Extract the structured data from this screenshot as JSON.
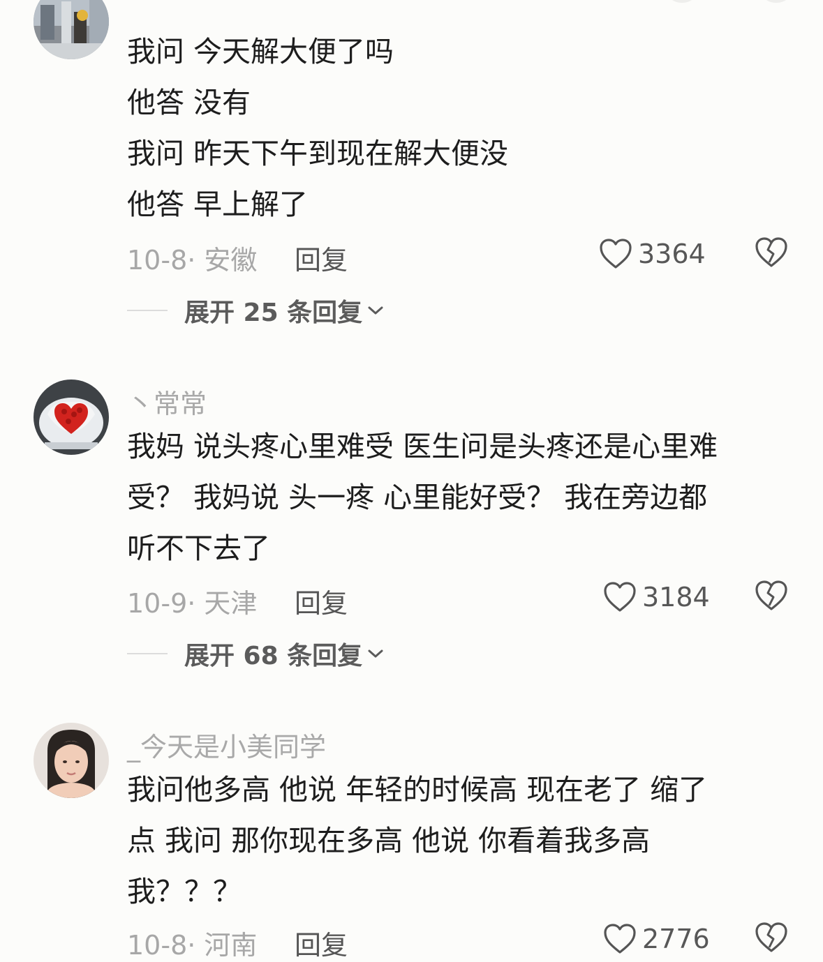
{
  "comments": [
    {
      "username": "",
      "lines": [
        "我问 今天解大便了吗",
        "他答 没有",
        "我问 昨天下午到现在解大便没",
        "他答 早上解了"
      ],
      "date_location": "10-8· 安徽",
      "reply_label": "回复",
      "likes": "3364",
      "expand_label": "展开 25 条回复"
    },
    {
      "username": "丶常常",
      "lines": [
        "我妈 说头疼心里难受 医生问是头疼还是心里难",
        "受？ 我妈说 头一疼 心里能好受？  我在旁边都",
        "听不下去了"
      ],
      "date_location": "10-9· 天津",
      "reply_label": "回复",
      "likes": "3184",
      "expand_label": "展开 68 条回复"
    },
    {
      "username": "_今天是小美同学",
      "lines": [
        "我问他多高  他说  年轻的时候高 现在老了 缩了",
        "点  我问 那你现在多高   他说 你看着我多高",
        "我？？？"
      ],
      "date_location": "10-8· 河南",
      "reply_label": "回复",
      "likes": "2776"
    }
  ],
  "icons": {
    "like": "heart-outline-icon",
    "dislike": "broken-heart-icon",
    "expand": "chevron-down-icon"
  },
  "colors": {
    "background": "#fcfcfa",
    "text": "#1d1d1d",
    "meta": "#a7a7a7",
    "username": "#a9a9a9"
  }
}
